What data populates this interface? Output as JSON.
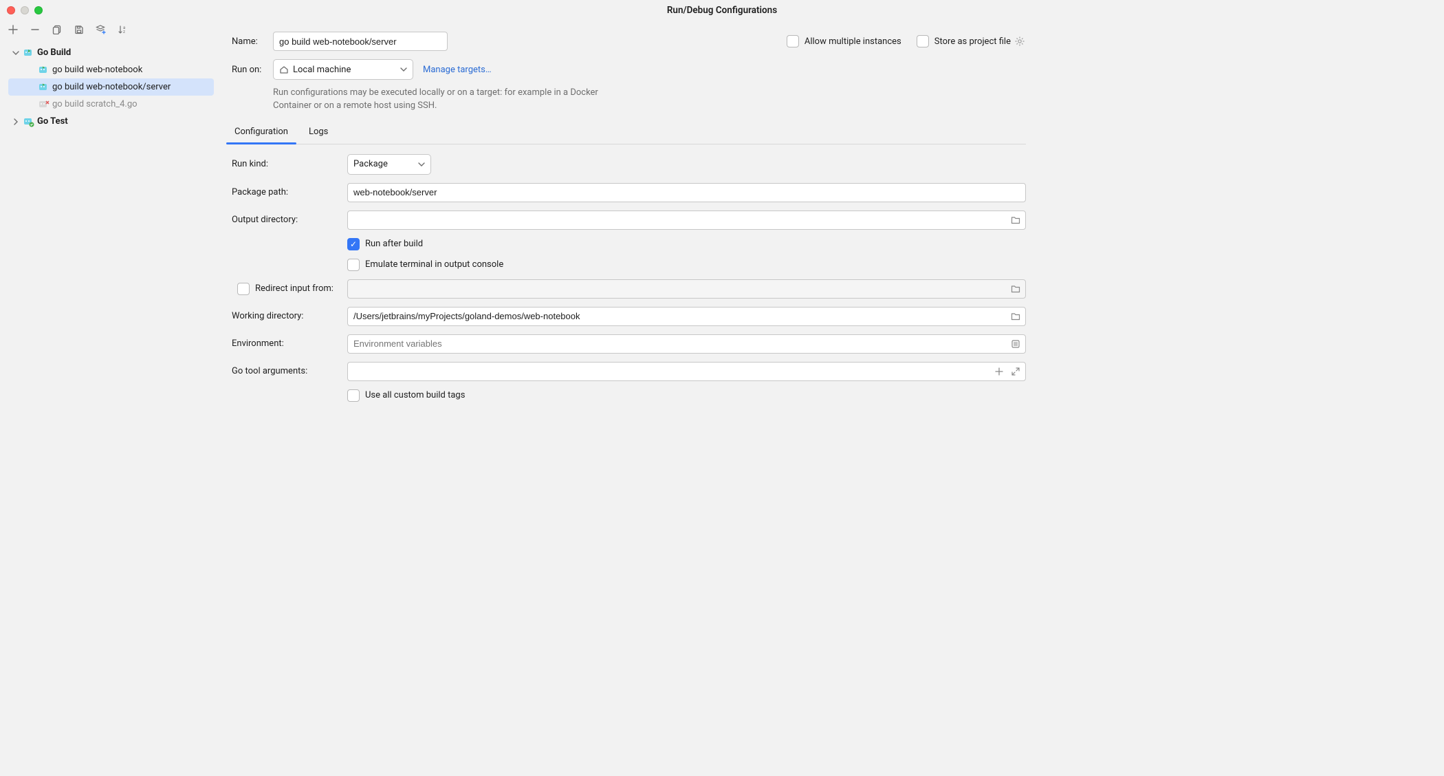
{
  "window": {
    "title": "Run/Debug Configurations"
  },
  "tree": {
    "categories": [
      {
        "label": "Go Build",
        "expanded": true,
        "items": [
          {
            "label": "go build web-notebook",
            "selected": false,
            "dim": false
          },
          {
            "label": "go build web-notebook/server",
            "selected": true,
            "dim": false
          },
          {
            "label": "go build scratch_4.go",
            "selected": false,
            "dim": true
          }
        ]
      },
      {
        "label": "Go Test",
        "expanded": false,
        "items": []
      }
    ]
  },
  "form": {
    "name_label": "Name:",
    "name_value": "go build web-notebook/server",
    "allow_multiple_label": "Allow multiple instances",
    "store_as_project_label": "Store as project file",
    "run_on_label": "Run on:",
    "run_on_value": "Local machine",
    "manage_targets": "Manage targets…",
    "run_on_hint": "Run configurations may be executed locally or on a target: for example in a Docker Container or on a remote host using SSH."
  },
  "tabs": [
    {
      "label": "Configuration",
      "active": true
    },
    {
      "label": "Logs",
      "active": false
    }
  ],
  "config": {
    "run_kind_label": "Run kind:",
    "run_kind_value": "Package",
    "package_path_label": "Package path:",
    "package_path_value": "web-notebook/server",
    "output_dir_label": "Output directory:",
    "output_dir_value": "",
    "run_after_build_label": "Run after build",
    "emulate_terminal_label": "Emulate terminal in output console",
    "redirect_input_label": "Redirect input from:",
    "redirect_input_value": "",
    "working_dir_label": "Working directory:",
    "working_dir_value": "/Users/jetbrains/myProjects/goland-demos/web-notebook",
    "environment_label": "Environment:",
    "environment_placeholder": "Environment variables",
    "go_tool_args_label": "Go tool arguments:",
    "go_tool_args_value": "",
    "use_custom_tags_label": "Use all custom build tags"
  }
}
